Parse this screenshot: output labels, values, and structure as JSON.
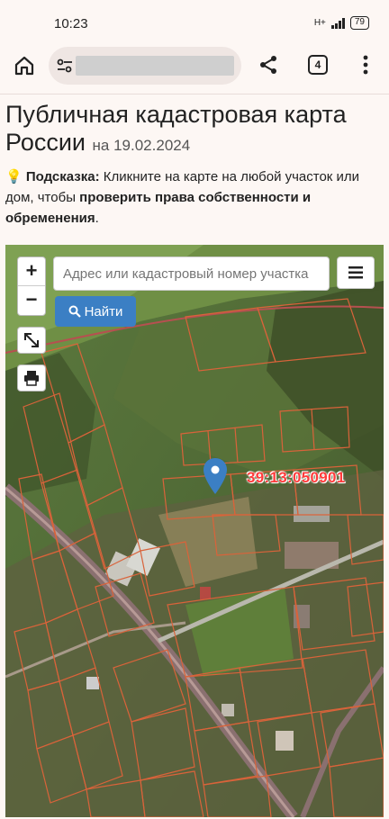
{
  "status_bar": {
    "time": "10:23",
    "network": "H+",
    "battery": "79"
  },
  "browser": {
    "tab_count": "4"
  },
  "page": {
    "title": "Публичная кадастровая карта России",
    "date": "на 19.02.2024",
    "hint_label": "Подсказка:",
    "hint_text_1": " Кликните на карте на любой участок или дом, чтобы ",
    "hint_bold": "проверить права собственности и обременения",
    "hint_text_2": "."
  },
  "map": {
    "search_placeholder": "Адрес или кадастровый номер участка",
    "find_label": "Найти",
    "zoom_in": "+",
    "zoom_out": "−",
    "cadastral_number": "39:13:050901",
    "colors": {
      "parcel": "#d9633a",
      "road": "#8a7070",
      "pin": "#3b7fc4",
      "label": "#ff3b3b"
    }
  }
}
